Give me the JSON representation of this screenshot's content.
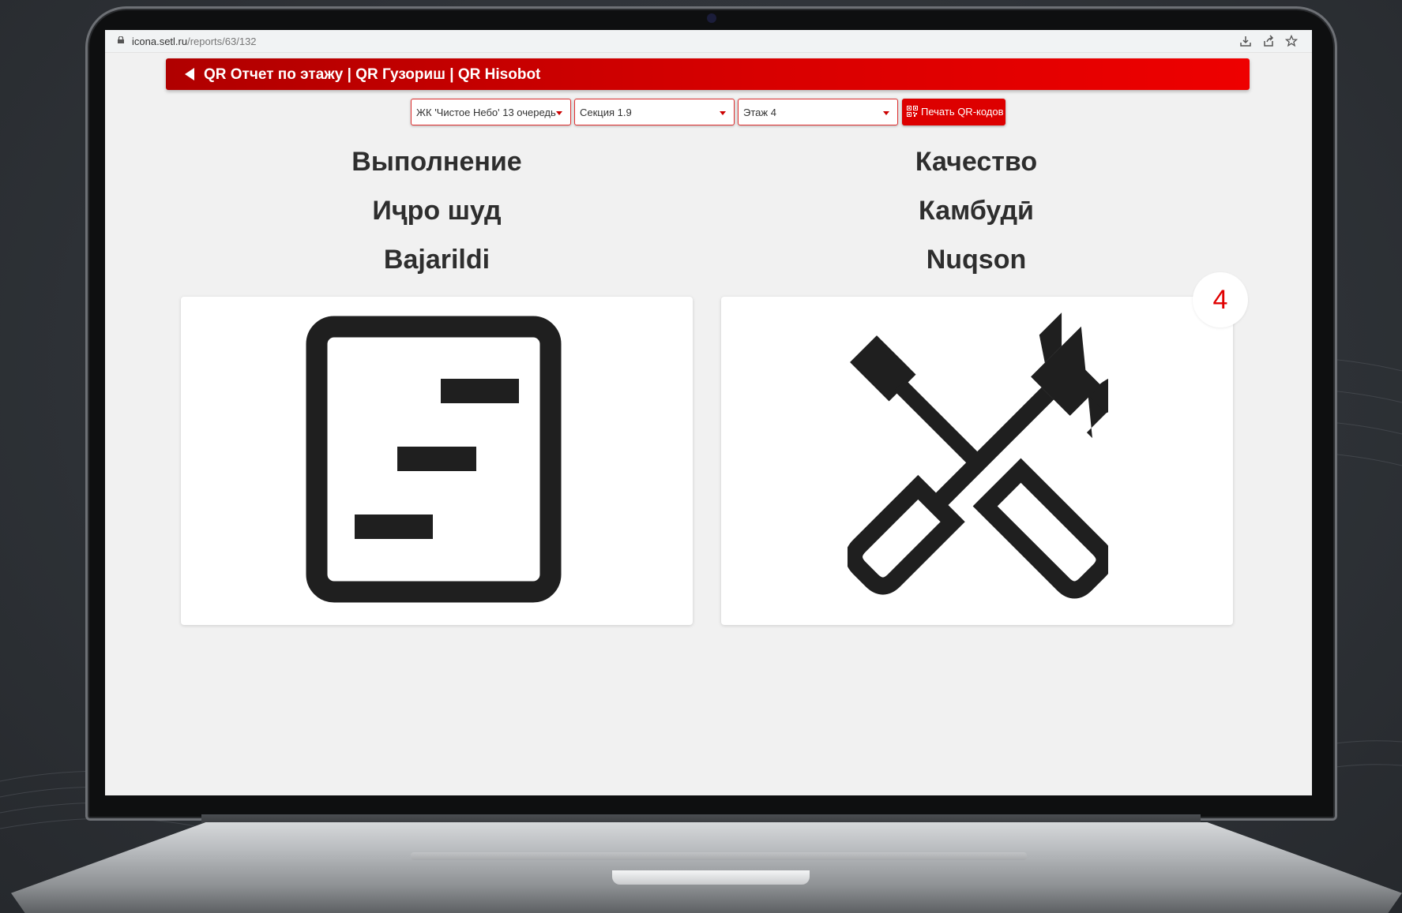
{
  "browser": {
    "url_host": "icona.setl.ru",
    "url_path": "/reports/63/132"
  },
  "header": {
    "title": "QR Отчет по этажу | QR Гузориш | QR Hisobot"
  },
  "filters": {
    "project": "ЖК 'Чистое Небо' 13 очередь",
    "section": "Секция 1.9",
    "floor": "Этаж 4",
    "print_button": "Печать QR-кодов"
  },
  "columns": [
    {
      "titles": [
        "Выполнение",
        "Иҷро шуд",
        "Bajarildi"
      ],
      "icon": "document-list-icon"
    },
    {
      "titles": [
        "Качество",
        "Камбудӣ",
        "Nuqson"
      ],
      "icon": "tools-icon",
      "badge": "4"
    }
  ],
  "colors": {
    "accent": "#dd0000",
    "header_dark": "#b00000",
    "icon": "#1f1f1f",
    "page_bg": "#f1f1f1"
  }
}
